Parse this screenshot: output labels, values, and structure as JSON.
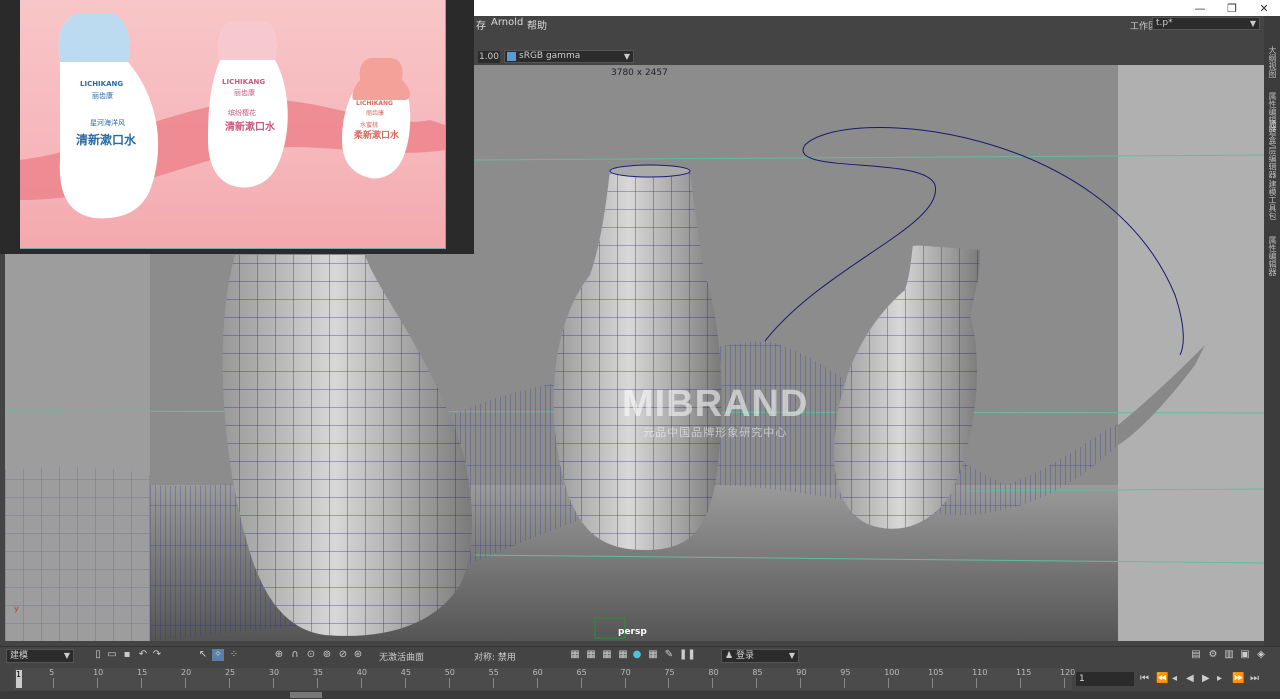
{
  "menu": {
    "partial_item": "存",
    "arnold": "Arnold",
    "help": "帮助"
  },
  "workspace": {
    "label": "工作区:",
    "value": "t.p*"
  },
  "window_controls": {
    "minimize": "—",
    "restore": "❐",
    "close": "✕"
  },
  "viewport_toolbar": {
    "gamma_value": "1.00",
    "color_space": "sRGB gamma"
  },
  "viewport": {
    "resolution": "3780 x 2457",
    "camera": "persp",
    "watermark_main": "MIBRAND",
    "watermark_sub": "元品中国品牌形象研究中心",
    "axis": "y"
  },
  "render_preview": {
    "bottles": [
      {
        "brand": "LICHIKANG",
        "cn_brand": "丽齿康",
        "line1": "星河海洋风",
        "product": "清新漱口水",
        "color": "#bcdaf0"
      },
      {
        "brand": "LICHIKANG",
        "cn_brand": "丽齿康",
        "line1": "缤纷樱花",
        "product": "清新漱口水",
        "color": "#f6c9cf"
      },
      {
        "brand": "LICHIKANG",
        "cn_brand": "丽齿康",
        "line1": "水蜜桃",
        "product": "柔新漱口水",
        "color": "#f4a19a"
      }
    ]
  },
  "right_strip": [
    "大纲视图",
    "属性编辑器",
    "通道盒/层编辑器",
    "建模工具包",
    "属性编辑器"
  ],
  "shelf": {
    "mode": "建模",
    "live_surface": "无激活曲面",
    "symmetry": "对称: 禁用",
    "login": "登录"
  },
  "timeline": {
    "ticks": [
      "1",
      "5",
      "10",
      "15",
      "20",
      "25",
      "30",
      "35",
      "40",
      "45",
      "50",
      "55",
      "60",
      "65",
      "70",
      "75",
      "80",
      "85",
      "90",
      "95",
      "100",
      "105",
      "110",
      "115",
      "120"
    ],
    "current_frame": "1",
    "frame_field": "1"
  },
  "colors": {
    "viewport_bg": "#8e8e8e",
    "wire": "#1a1a7a",
    "ui_bg": "#444444",
    "render_bg": "#f6b7bb"
  }
}
